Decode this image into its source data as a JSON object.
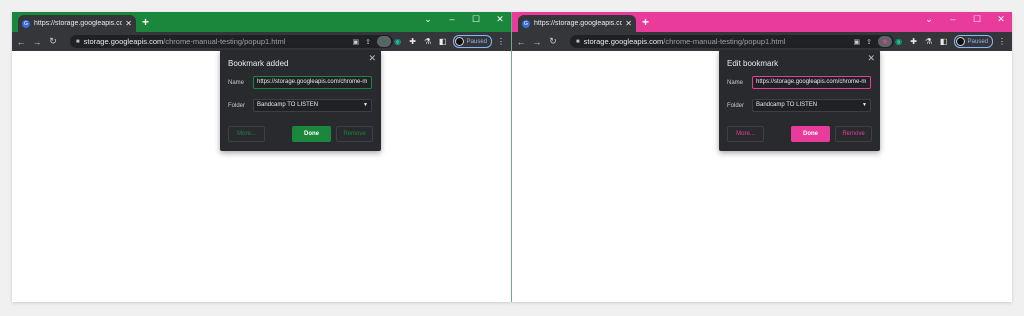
{
  "windows": [
    {
      "accent": "#1a873c",
      "tab": {
        "title": "https://storage.googleapis.com/",
        "close": "✕",
        "favicon": "G"
      },
      "new_tab": "+",
      "controls": {
        "min": "⌄",
        "restore": "–",
        "max": "☐",
        "close": "✕"
      },
      "nav": {
        "back": "←",
        "forward": "→",
        "reload": "↻"
      },
      "address": {
        "host": "storage.googleapis.com",
        "path": "/chrome-manual-testing/popup1.html"
      },
      "profile": {
        "label": "Paused"
      },
      "bookmark_popup": {
        "title": "Bookmark added",
        "name_label": "Name",
        "name_value": "https://storage.googleapis.com/chrome-m",
        "folder_label": "Folder",
        "folder_value": "Bandcamp TO LISTEN",
        "more_label": "More...",
        "done_label": "Done",
        "remove_label": "Remove"
      }
    },
    {
      "accent": "#e83b9c",
      "tab": {
        "title": "https://storage.googleapis.com/",
        "close": "✕",
        "favicon": "G"
      },
      "new_tab": "+",
      "controls": {
        "min": "⌄",
        "restore": "–",
        "max": "☐",
        "close": "✕"
      },
      "nav": {
        "back": "←",
        "forward": "→",
        "reload": "↻"
      },
      "address": {
        "host": "storage.googleapis.com",
        "path": "/chrome-manual-testing/popup1.html"
      },
      "profile": {
        "label": "Paused"
      },
      "bookmark_popup": {
        "title": "Edit bookmark",
        "name_label": "Name",
        "name_value": "https://storage.googleapis.com/chrome-m",
        "folder_label": "Folder",
        "folder_value": "Bandcamp TO LISTEN",
        "more_label": "More...",
        "done_label": "Done",
        "remove_label": "Remove"
      }
    }
  ],
  "divider_color": "#7bc29a"
}
